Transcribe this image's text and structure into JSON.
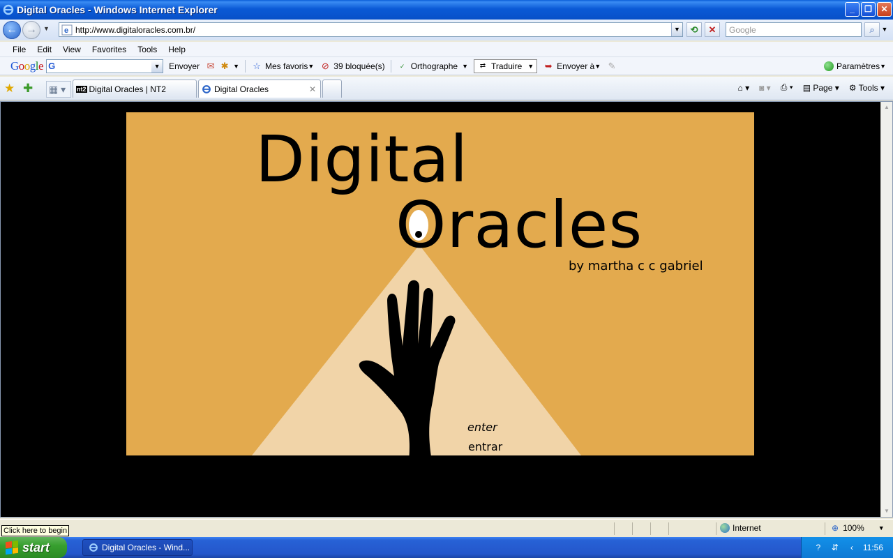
{
  "window": {
    "title": "Digital Oracles - Windows Internet Explorer"
  },
  "address_bar": {
    "url": "http://www.digitaloracles.com.br/",
    "search_placeholder": "Google"
  },
  "menu": [
    "File",
    "Edit",
    "View",
    "Favorites",
    "Tools",
    "Help"
  ],
  "google_toolbar": {
    "logo": [
      "G",
      "o",
      "o",
      "g",
      "l",
      "e"
    ],
    "envoyer": "Envoyer",
    "mes_favoris": "Mes favoris",
    "blocked": "39 bloquée(s)",
    "orthographe": "Orthographe",
    "traduire": "Traduire",
    "envoyer_a": "Envoyer à",
    "parametres": "Paramètres"
  },
  "tabs": [
    {
      "label": "Digital Oracles | NT2",
      "icon": "nt2"
    },
    {
      "label": "Digital Oracles",
      "active": true
    }
  ],
  "command_bar": {
    "page": "Page",
    "tools": "Tools"
  },
  "page": {
    "title_line1": "Digital",
    "title_line2": "Oracles",
    "byline": "by martha c c gabriel",
    "enter": "enter",
    "entrar": "entrar",
    "colors": {
      "stage": "#e3aa4e",
      "beam": "#f1d4a8",
      "background": "#000000"
    }
  },
  "status": {
    "tooltip": "Click here to begin",
    "zone": "Internet",
    "zoom": "100%"
  },
  "taskbar": {
    "start": "start",
    "window_button": "Digital Oracles - Wind...",
    "clock": "11:56"
  }
}
